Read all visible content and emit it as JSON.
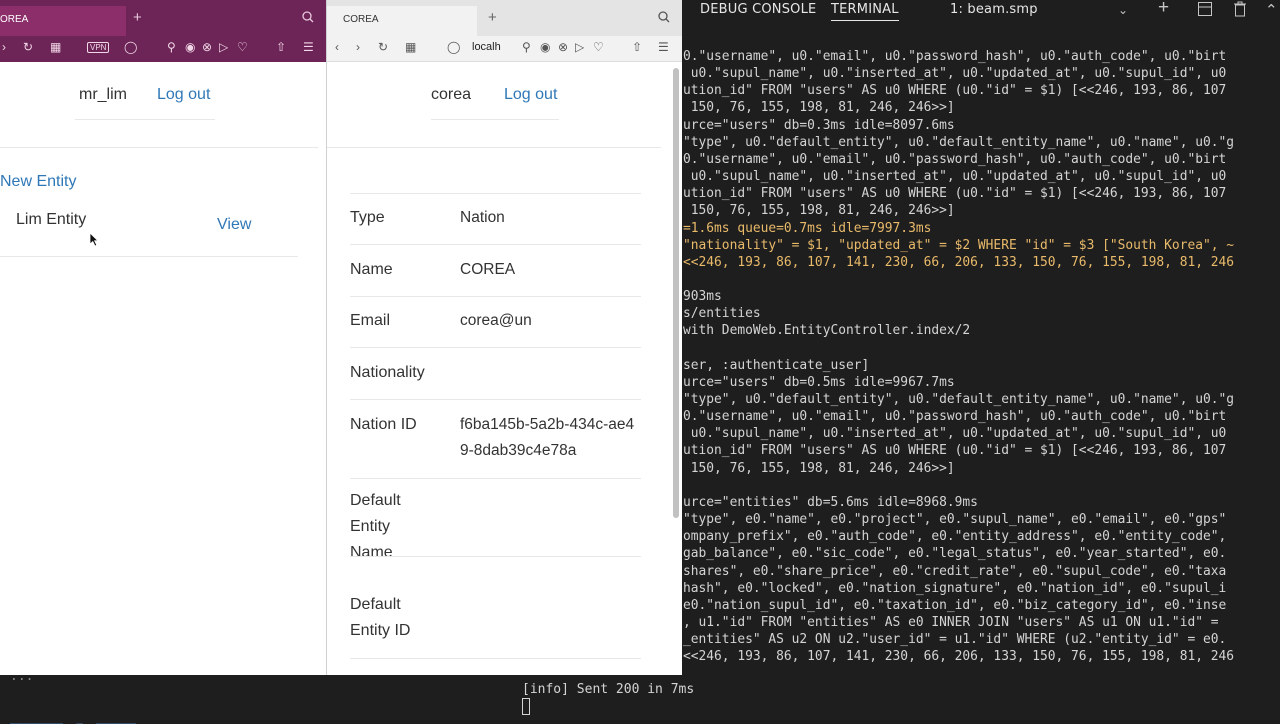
{
  "panel": {
    "debug_console": "DEBUG CONSOLE",
    "terminal": "TERMINAL",
    "terminal_select": "1: beam.smp"
  },
  "terminal_lines": [
    {
      "text": "0.\"username\", u0.\"email\", u0.\"password_hash\", u0.\"auth_code\", u0.\"birt",
      "style": "normal"
    },
    {
      "text": " u0.\"supul_name\", u0.\"inserted_at\", u0.\"updated_at\", u0.\"supul_id\", u0",
      "style": "normal"
    },
    {
      "text": "ution_id\" FROM \"users\" AS u0 WHERE (u0.\"id\" = $1) [<<246, 193, 86, 107",
      "style": "normal"
    },
    {
      "text": " 150, 76, 155, 198, 81, 246, 246>>]",
      "style": "normal"
    },
    {
      "text": "urce=\"users\" db=0.3ms idle=8097.6ms",
      "style": "normal"
    },
    {
      "text": "\"type\", u0.\"default_entity\", u0.\"default_entity_name\", u0.\"name\", u0.\"g",
      "style": "normal"
    },
    {
      "text": "0.\"username\", u0.\"email\", u0.\"password_hash\", u0.\"auth_code\", u0.\"birt",
      "style": "normal"
    },
    {
      "text": " u0.\"supul_name\", u0.\"inserted_at\", u0.\"updated_at\", u0.\"supul_id\", u0",
      "style": "normal"
    },
    {
      "text": "ution_id\" FROM \"users\" AS u0 WHERE (u0.\"id\" = $1) [<<246, 193, 86, 107",
      "style": "normal"
    },
    {
      "text": " 150, 76, 155, 198, 81, 246, 246>>]",
      "style": "normal"
    },
    {
      "text": "=1.6ms queue=0.7ms idle=7997.3ms",
      "style": "orange"
    },
    {
      "text": "\"nationality\" = $1, \"updated_at\" = $2 WHERE \"id\" = $3 [\"South Korea\", ~",
      "style": "orange"
    },
    {
      "text": "<<246, 193, 86, 107, 141, 230, 66, 206, 133, 150, 76, 155, 198, 81, 246",
      "style": "orange"
    },
    {
      "text": "",
      "style": "normal"
    },
    {
      "text": "903ms",
      "style": "normal"
    },
    {
      "text": "s/entities",
      "style": "normal"
    },
    {
      "text": "with DemoWeb.EntityController.index/2",
      "style": "normal"
    },
    {
      "text": "",
      "style": "normal"
    },
    {
      "text": "ser, :authenticate_user]",
      "style": "normal"
    },
    {
      "text": "urce=\"users\" db=0.5ms idle=9967.7ms",
      "style": "normal"
    },
    {
      "text": "\"type\", u0.\"default_entity\", u0.\"default_entity_name\", u0.\"name\", u0.\"g",
      "style": "normal"
    },
    {
      "text": "0.\"username\", u0.\"email\", u0.\"password_hash\", u0.\"auth_code\", u0.\"birt",
      "style": "normal"
    },
    {
      "text": " u0.\"supul_name\", u0.\"inserted_at\", u0.\"updated_at\", u0.\"supul_id\", u0",
      "style": "normal"
    },
    {
      "text": "ution_id\" FROM \"users\" AS u0 WHERE (u0.\"id\" = $1) [<<246, 193, 86, 107",
      "style": "normal"
    },
    {
      "text": " 150, 76, 155, 198, 81, 246, 246>>]",
      "style": "normal"
    },
    {
      "text": "",
      "style": "normal"
    },
    {
      "text": "urce=\"entities\" db=5.6ms idle=8968.9ms",
      "style": "normal"
    },
    {
      "text": "\"type\", e0.\"name\", e0.\"project\", e0.\"supul_name\", e0.\"email\", e0.\"gps\"",
      "style": "normal"
    },
    {
      "text": "ompany_prefix\", e0.\"auth_code\", e0.\"entity_address\", e0.\"entity_code\",",
      "style": "normal"
    },
    {
      "text": "gab_balance\", e0.\"sic_code\", e0.\"legal_status\", e0.\"year_started\", e0.",
      "style": "normal"
    },
    {
      "text": "shares\", e0.\"share_price\", e0.\"credit_rate\", e0.\"supul_code\", e0.\"taxa",
      "style": "normal"
    },
    {
      "text": "hash\", e0.\"locked\", e0.\"nation_signature\", e0.\"nation_id\", e0.\"supul_i",
      "style": "normal"
    },
    {
      "text": "e0.\"nation_supul_id\", e0.\"taxation_id\", e0.\"biz_category_id\", e0.\"inse",
      "style": "normal"
    },
    {
      "text": ", u1.\"id\" FROM \"entities\" AS e0 INNER JOIN \"users\" AS u1 ON u1.\"id\" = ",
      "style": "normal"
    },
    {
      "text": "_entities\" AS u2 ON u2.\"user_id\" = u1.\"id\" WHERE (u2.\"entity_id\" = e0.",
      "style": "normal"
    },
    {
      "text": "<<246, 193, 86, 107, 141, 230, 66, 206, 133, 150, 76, 155, 198, 81, 246",
      "style": "normal"
    }
  ],
  "bottom_terminal": {
    "left_text": "...",
    "left_text2": "________  _  ______",
    "line1": "[info] Sent 200 in 7ms"
  },
  "browser_left": {
    "tab_title": "OREA",
    "vpn": "VPN",
    "username": "mr_lim",
    "logout": "Log out",
    "new_entity": "New Entity",
    "entity_name": "Lim Entity",
    "view": "View"
  },
  "browser_right": {
    "tab_title": "COREA",
    "url": "localh",
    "username": "corea",
    "logout": "Log out",
    "rows": [
      {
        "label": "Type",
        "value": "Nation"
      },
      {
        "label": "Name",
        "value": "COREA"
      },
      {
        "label": "Email",
        "value": "corea@un"
      },
      {
        "label": "Nationality",
        "value": ""
      },
      {
        "label": "Nation ID",
        "value": "f6ba145b-5a2b-434c-ae49-8dab39c4e78a"
      },
      {
        "label": "Default Entity Name",
        "value": ""
      },
      {
        "label": "Default Entity ID",
        "value": ""
      }
    ]
  }
}
